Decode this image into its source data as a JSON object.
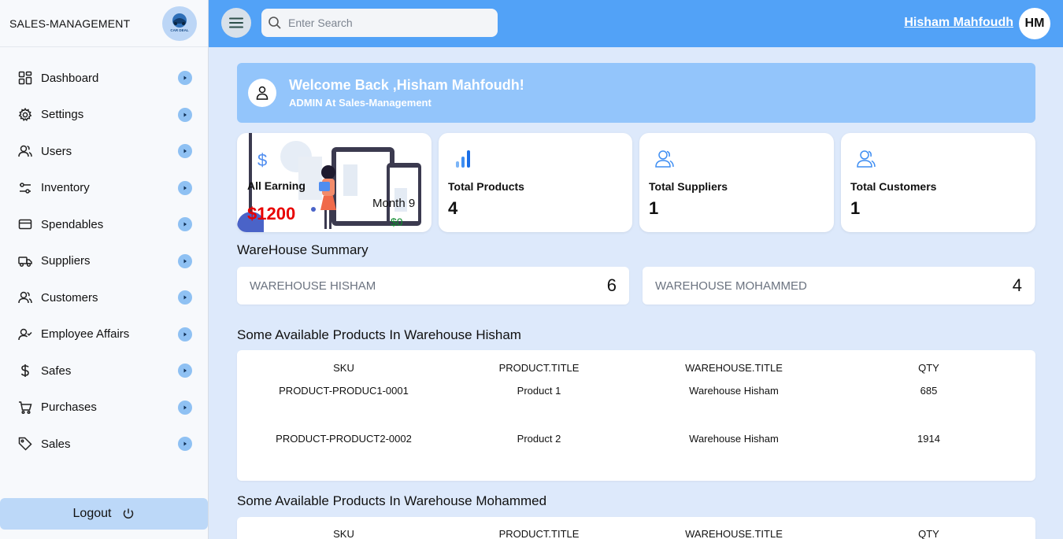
{
  "sidebar": {
    "brand": "SALES-MANAGEMENT",
    "logo_text": "CAR DEAL",
    "items": [
      {
        "label": "Dashboard",
        "icon": "dashboard-icon"
      },
      {
        "label": "Settings",
        "icon": "gear-icon"
      },
      {
        "label": "Users",
        "icon": "users-icon"
      },
      {
        "label": "Inventory",
        "icon": "sliders-icon"
      },
      {
        "label": "Spendables",
        "icon": "credit-card-icon"
      },
      {
        "label": "Suppliers",
        "icon": "truck-icon"
      },
      {
        "label": "Customers",
        "icon": "users-icon"
      },
      {
        "label": "Employee Affairs",
        "icon": "user-check-icon"
      },
      {
        "label": "Safes",
        "icon": "dollar-icon"
      },
      {
        "label": "Purchases",
        "icon": "cart-icon"
      },
      {
        "label": "Sales",
        "icon": "tag-icon"
      }
    ],
    "logout_label": "Logout"
  },
  "topbar": {
    "search_placeholder": "Enter Search",
    "user_name": "Hisham Mahfoudh",
    "user_initials": "HM"
  },
  "welcome": {
    "title": "Welcome Back ,Hisham Mahfoudh!",
    "subtitle": "ADMIN At Sales-Management"
  },
  "cards": {
    "earning": {
      "label": "All Earning",
      "value": "$1200",
      "month_label": "Month 9",
      "month_value": "$0"
    },
    "products": {
      "label": "Total Products",
      "value": "4"
    },
    "suppliers": {
      "label": "Total Suppliers",
      "value": "1"
    },
    "customers": {
      "label": "Total Customers",
      "value": "1"
    }
  },
  "warehouse_summary": {
    "title": "WareHouse Summary",
    "items": [
      {
        "name": "WAREHOUSE HISHAM",
        "count": "6"
      },
      {
        "name": "WAREHOUSE MOHAMMED",
        "count": "4"
      }
    ]
  },
  "tables": [
    {
      "title": "Some Available Products In Warehouse Hisham",
      "headers": [
        "SKU",
        "PRODUCT.TITLE",
        "WAREHOUSE.TITLE",
        "QTY"
      ],
      "rows": [
        [
          "PRODUCT-PRODUC1-0001",
          "Product 1",
          "Warehouse Hisham",
          "685"
        ],
        [
          "PRODUCT-PRODUCT2-0002",
          "Product 2",
          "Warehouse Hisham",
          "1914"
        ]
      ]
    },
    {
      "title": "Some Available Products In Warehouse Mohammed",
      "headers": [
        "SKU",
        "PRODUCT.TITLE",
        "WAREHOUSE.TITLE",
        "QTY"
      ],
      "rows": []
    }
  ],
  "colors": {
    "topbar": "#52a2f7",
    "welcome": "#93c5fb",
    "background": "#dde9fb",
    "earning": "#e80000",
    "month_value": "#0d8a2c"
  }
}
